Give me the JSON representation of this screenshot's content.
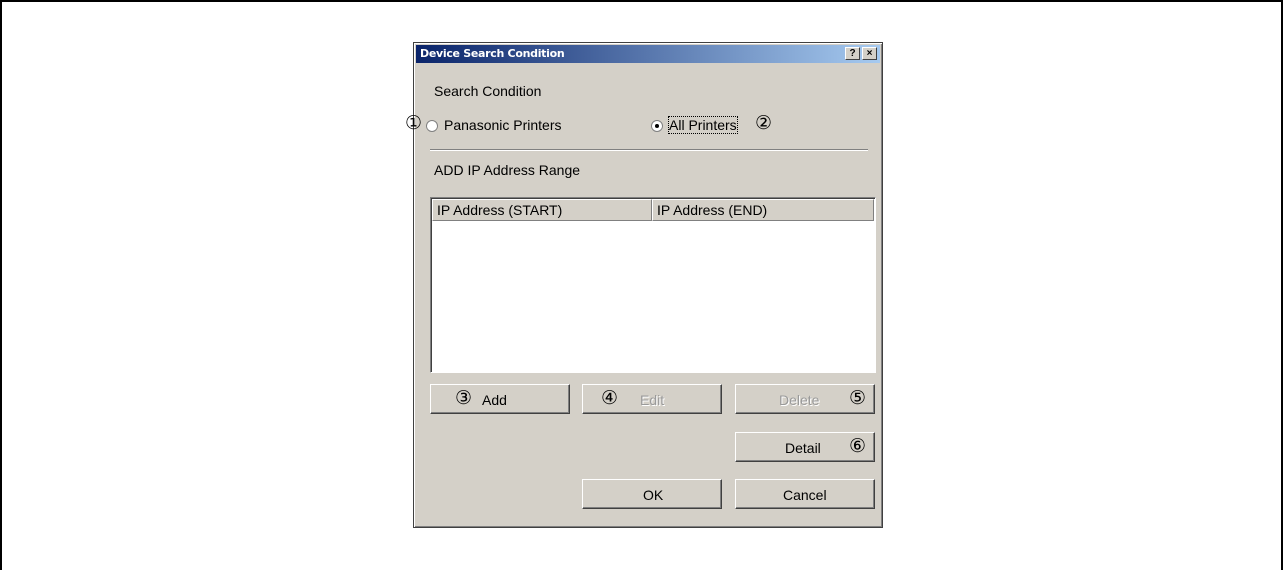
{
  "dialog": {
    "title": "Device Search Condition",
    "help_button": "?",
    "close_button": "×",
    "search_condition": {
      "group_label": "Search Condition",
      "option_panasonic": "Panasonic Printers",
      "option_all": "All Printers",
      "selected": "All Printers"
    },
    "ip_range": {
      "group_label": "ADD IP Address Range",
      "columns": [
        "IP Address (START)",
        "IP Address (END)"
      ],
      "rows": []
    },
    "buttons": {
      "add": "Add",
      "edit": "Edit",
      "delete": "Delete",
      "detail": "Detail",
      "ok": "OK",
      "cancel": "Cancel"
    }
  },
  "callouts": [
    "①",
    "②",
    "③",
    "④",
    "⑤",
    "⑥"
  ]
}
